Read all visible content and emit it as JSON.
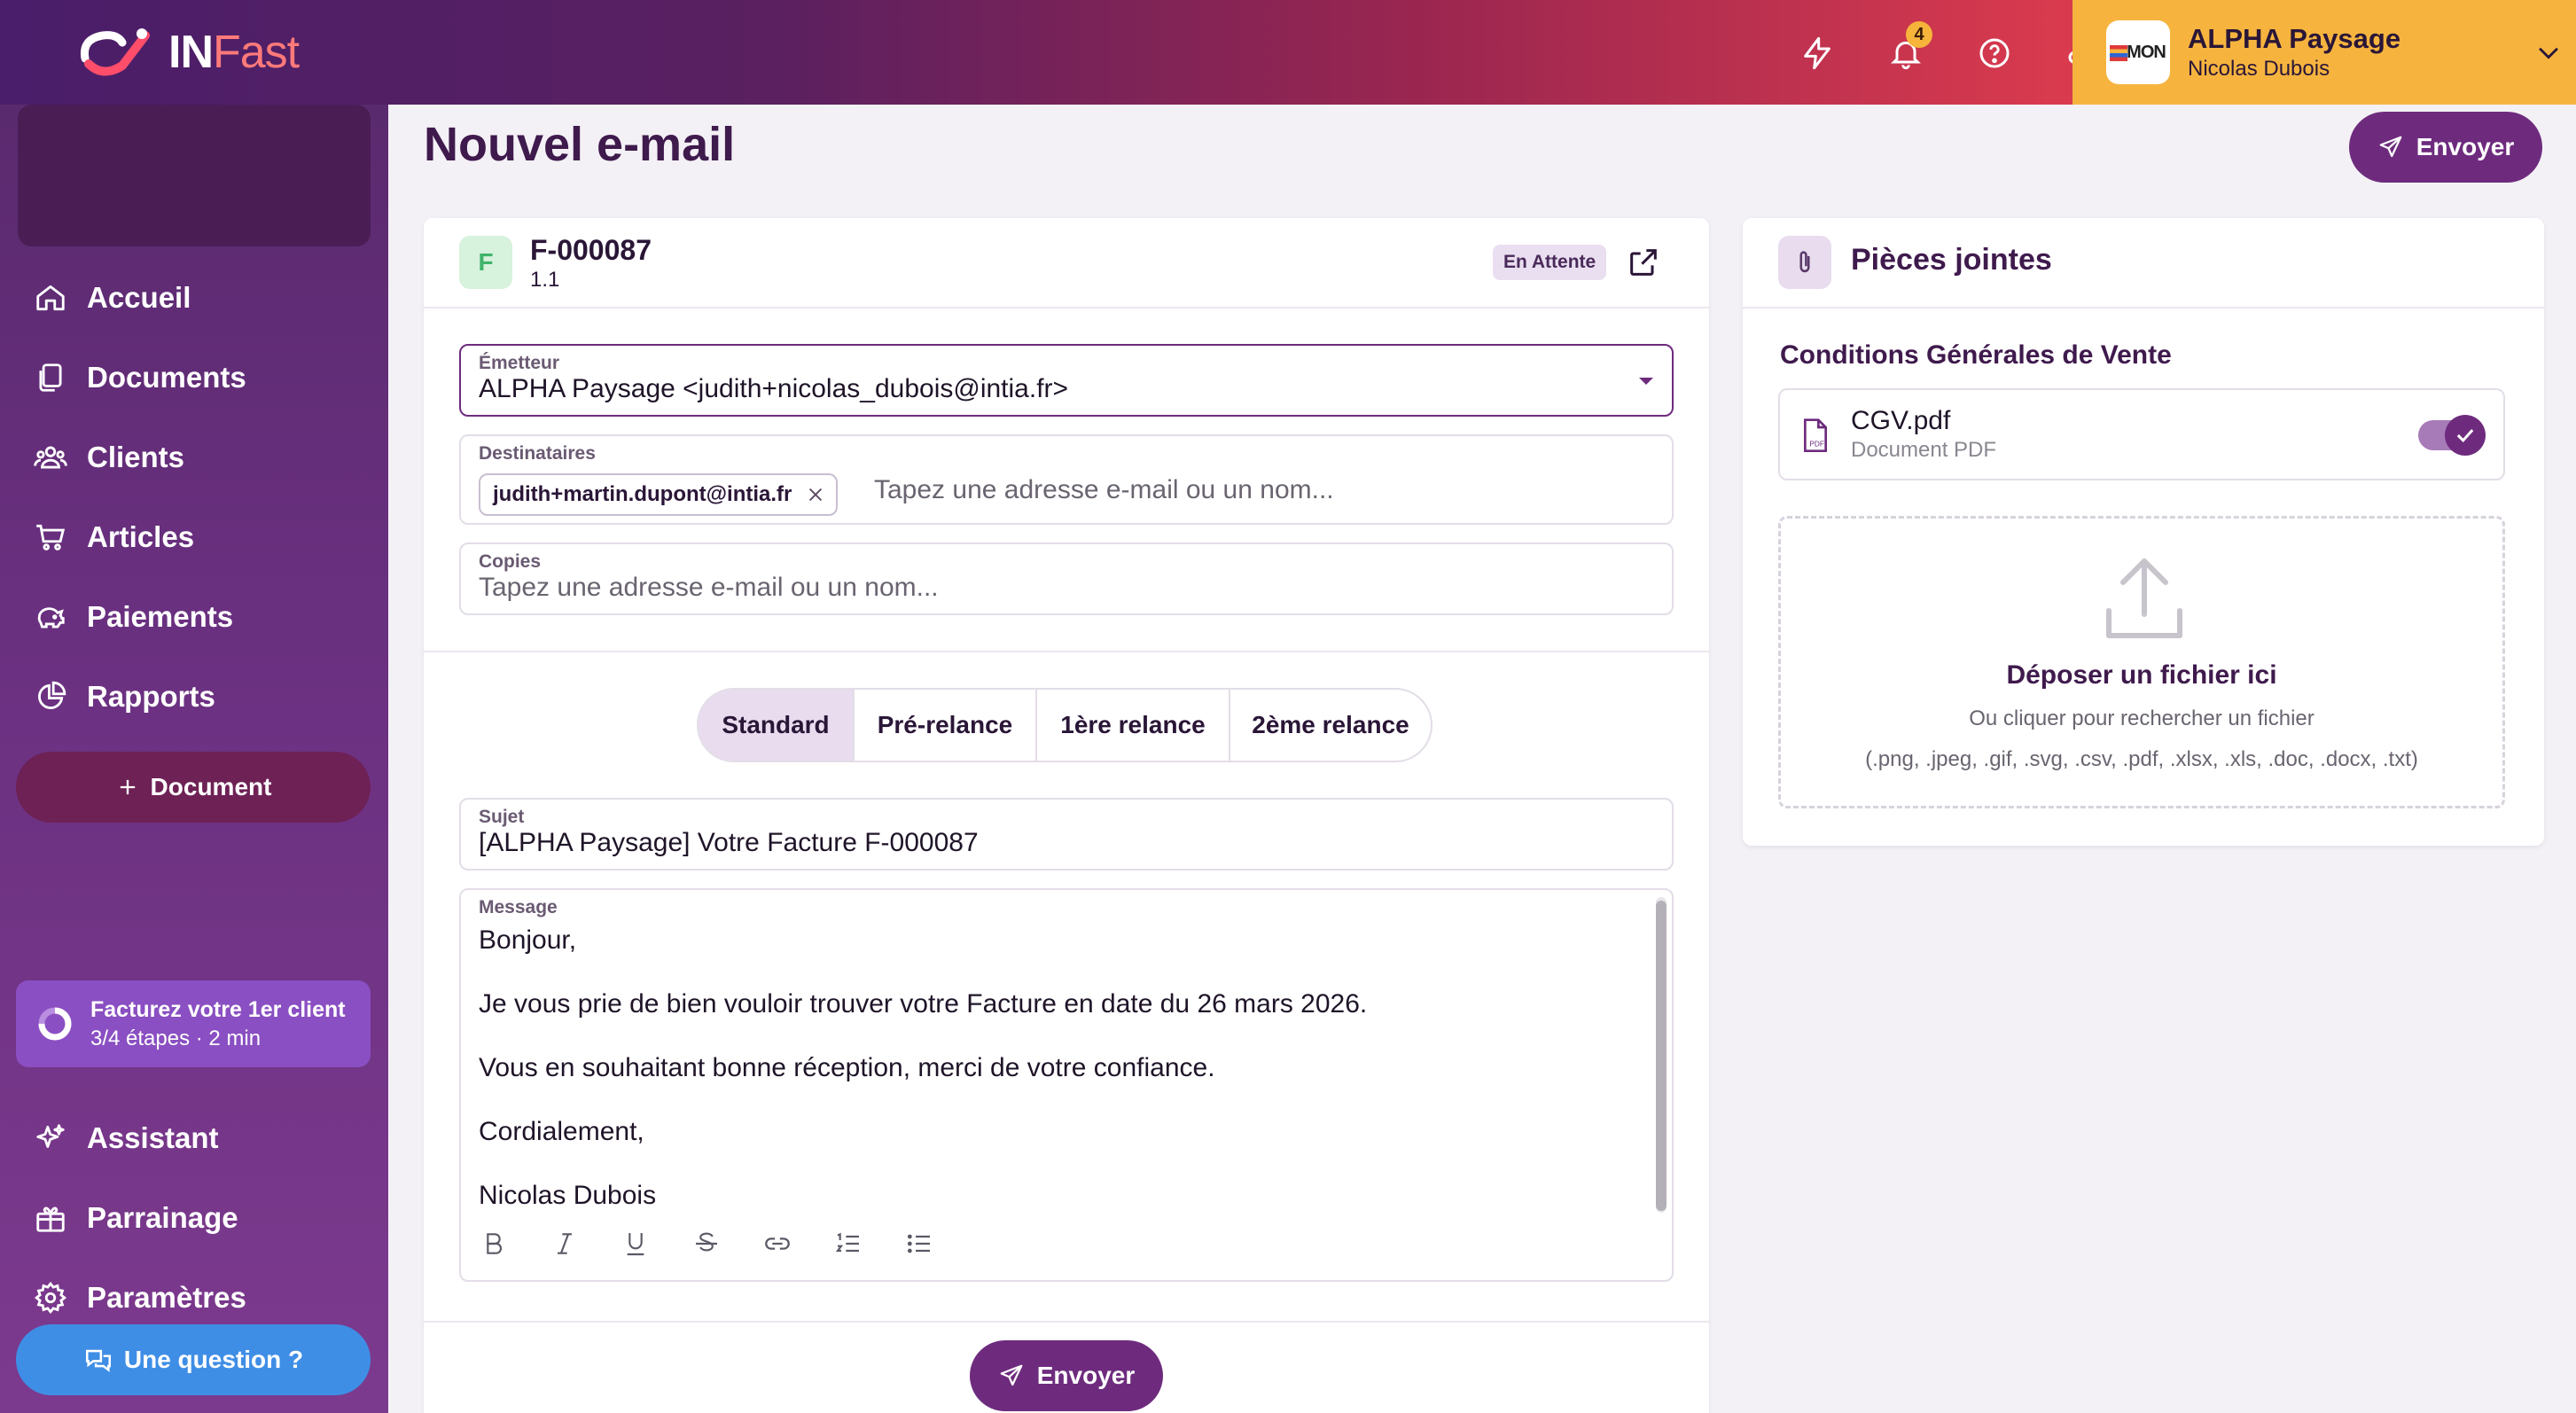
{
  "app": {
    "logo_prefix": "IN",
    "logo_suffix": "Fast"
  },
  "topbar": {
    "notifications_count": "4",
    "company": {
      "name": "ALPHA Paysage",
      "user": "Nicolas Dubois",
      "logo_text": "MON"
    }
  },
  "sidebar": {
    "items": [
      {
        "label": "Accueil",
        "icon": "home-icon"
      },
      {
        "label": "Documents",
        "icon": "documents-icon"
      },
      {
        "label": "Clients",
        "icon": "clients-icon"
      },
      {
        "label": "Articles",
        "icon": "cart-icon"
      },
      {
        "label": "Paiements",
        "icon": "piggy-bank-icon"
      },
      {
        "label": "Rapports",
        "icon": "pie-chart-icon"
      }
    ],
    "new_document_label": "Document",
    "onboarding": {
      "title": "Facturez votre 1er client",
      "subtitle": "3/4 étapes · 2 min",
      "progress": 0.75
    },
    "bottom_items": [
      {
        "label": "Assistant",
        "icon": "sparkles-icon"
      },
      {
        "label": "Parrainage",
        "icon": "gift-icon"
      },
      {
        "label": "Paramètres",
        "icon": "gear-icon"
      }
    ],
    "question_label": "Une question ?"
  },
  "page": {
    "title": "Nouvel e-mail",
    "send_label": "Envoyer"
  },
  "document": {
    "badge": "F",
    "number": "F-000087",
    "version": "1.1",
    "status": "En Attente"
  },
  "form": {
    "sender": {
      "label": "Émetteur",
      "value": "ALPHA Paysage <judith+nicolas_dubois@intia.fr>"
    },
    "recipients": {
      "label": "Destinataires",
      "chip": "judith+martin.dupont@intia.fr",
      "placeholder": "Tapez une adresse e-mail ou un nom..."
    },
    "copies": {
      "label": "Copies",
      "placeholder": "Tapez une adresse e-mail ou un nom..."
    },
    "templates": [
      "Standard",
      "Pré-relance",
      "1ère relance",
      "2ème relance"
    ],
    "selected_template": "Standard",
    "subject": {
      "label": "Sujet",
      "value": "[ALPHA Paysage] Votre Facture F-000087"
    },
    "message": {
      "label": "Message",
      "lines": [
        "Bonjour,",
        "Je vous prie de bien vouloir trouver votre Facture en date du 26 mars 2026.",
        "Vous en souhaitant bonne réception, merci de votre confiance.",
        "Cordialement,",
        "Nicolas Dubois"
      ]
    },
    "send_label": "Envoyer"
  },
  "attachments": {
    "title": "Pièces jointes",
    "section_title": "Conditions Générales de Vente",
    "file": {
      "name": "CGV.pdf",
      "type": "Document PDF",
      "enabled": true
    },
    "dropzone": {
      "title": "Déposer un fichier ici",
      "subtitle": "Ou cliquer pour rechercher un fichier",
      "extensions": "(.png, .jpeg, .gif, .svg, .csv, .pdf, .xlsx, .xls, .doc, .docx, .txt)"
    }
  },
  "colors": {
    "primary": "#6e2b7e",
    "accent_yellow": "#f6b43f",
    "question_blue": "#3f8ee6"
  }
}
